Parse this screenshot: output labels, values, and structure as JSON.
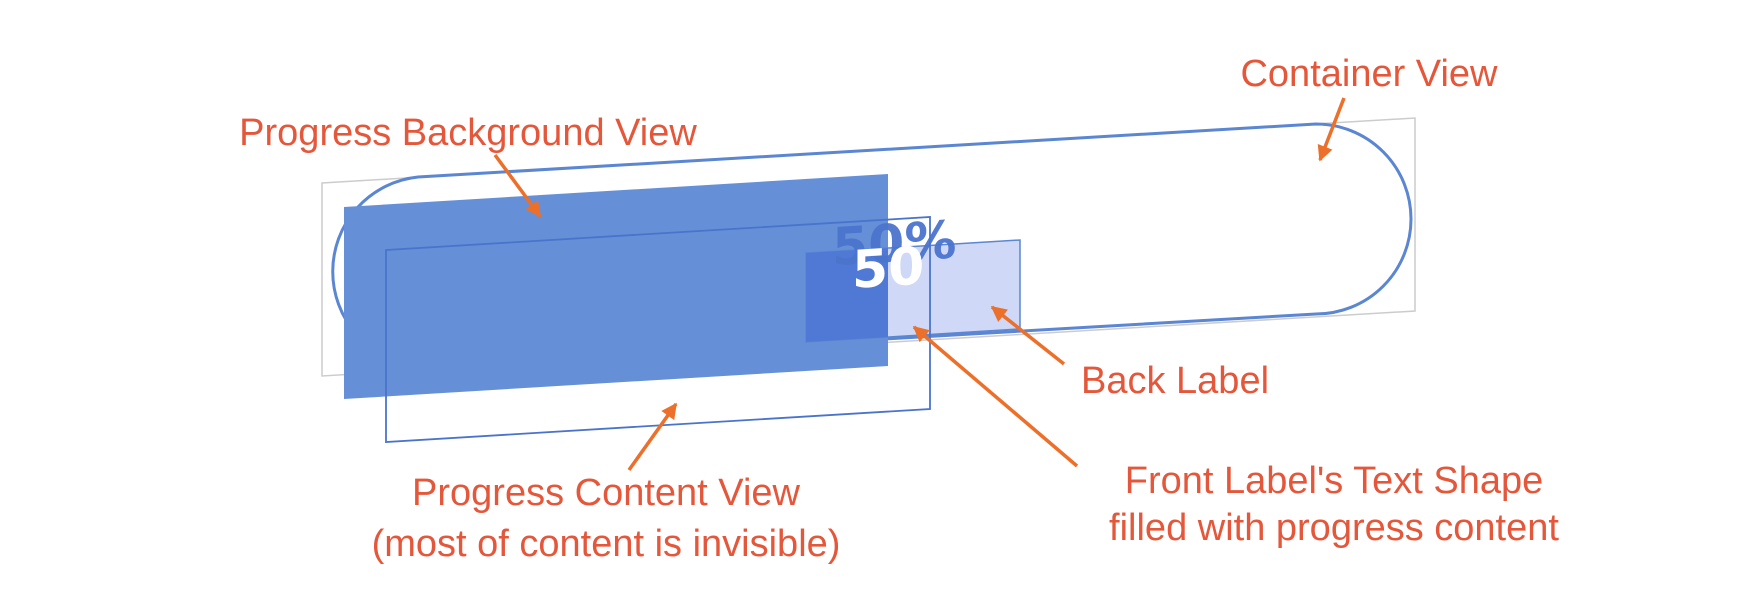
{
  "labels": {
    "container_view": "Container View",
    "progress_background_view": "Progress Background View",
    "back_label": "Back Label",
    "progress_content_view_line1": "Progress Content View",
    "progress_content_view_line2": "(most of content is invisible)",
    "front_label_line1": "Front Label's Text Shape",
    "front_label_line2": "filled with progress content"
  },
  "percent_text": {
    "back": "50%",
    "front": "50"
  },
  "colors": {
    "callout_text": "#e4573a",
    "arrow": "#ec6f2a",
    "progress_fill": "#6590d8",
    "outline": "#5b86d2",
    "back_label_fill": "#cfd9f7",
    "back_label_text": "#4b74cc",
    "front_label_text": "#ffffff",
    "frame_gray": "#cccccc"
  }
}
